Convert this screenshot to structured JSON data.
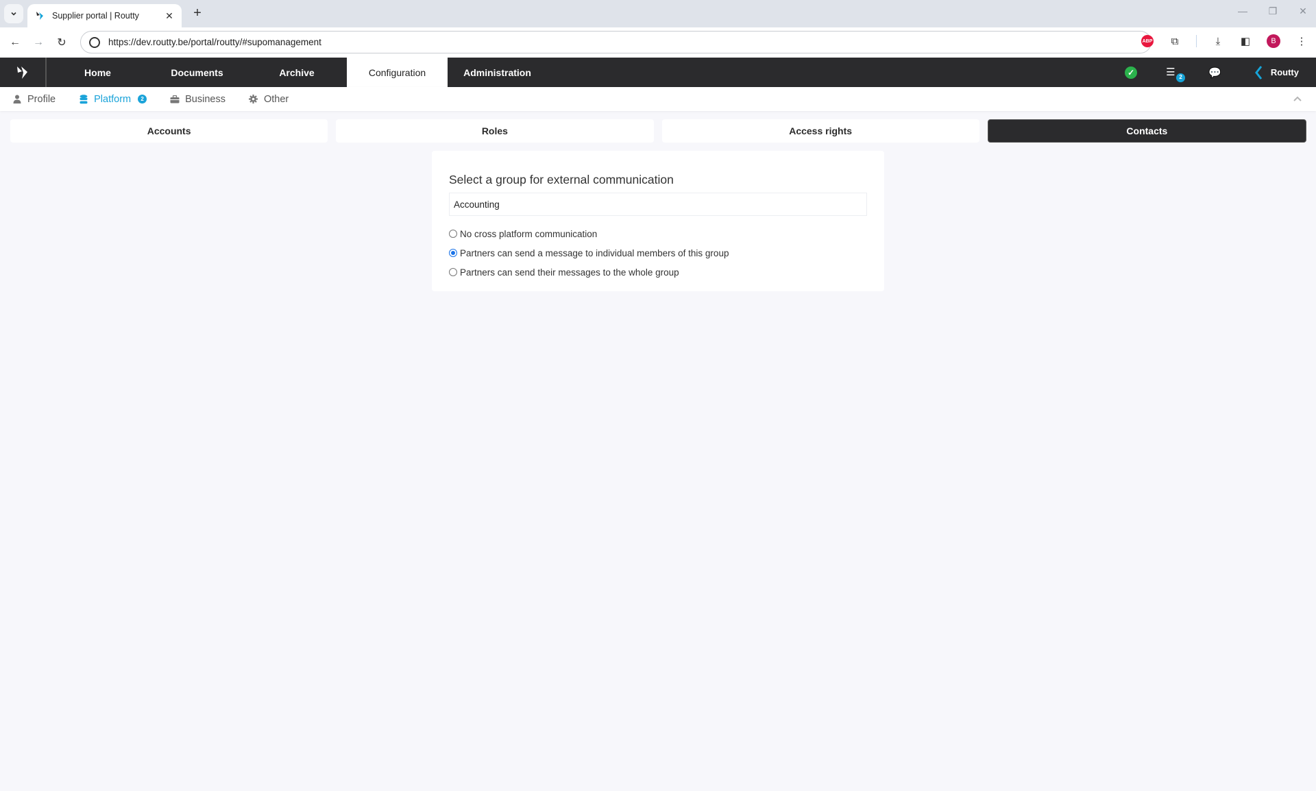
{
  "browser": {
    "tab_title": "Supplier portal | Routty",
    "url": "https://dev.routty.be/portal/routty/#supomanagement",
    "profile_initial": "B",
    "abp_label": "ABP"
  },
  "topnav": {
    "items": [
      {
        "label": "Home",
        "active": false
      },
      {
        "label": "Documents",
        "active": false
      },
      {
        "label": "Archive",
        "active": false
      },
      {
        "label": "Configuration",
        "active": true
      },
      {
        "label": "Administration",
        "active": false
      }
    ],
    "tasks_badge": "2",
    "brand_name": "Routty"
  },
  "subnav": {
    "items": [
      {
        "label": "Profile",
        "icon": "user-icon",
        "active": false
      },
      {
        "label": "Platform",
        "icon": "database-icon",
        "active": true,
        "badge": "2"
      },
      {
        "label": "Business",
        "icon": "briefcase-icon",
        "active": false
      },
      {
        "label": "Other",
        "icon": "gear-icon",
        "active": false
      }
    ]
  },
  "section_tabs": [
    {
      "label": "Accounts",
      "active": false
    },
    {
      "label": "Roles",
      "active": false
    },
    {
      "label": "Access rights",
      "active": false
    },
    {
      "label": "Contacts",
      "active": true
    }
  ],
  "card": {
    "title": "Select a group for external communication",
    "group_value": "Accounting",
    "options": [
      {
        "label": "No cross platform communication",
        "checked": false
      },
      {
        "label": "Partners can send a message to individual members of this group",
        "checked": true
      },
      {
        "label": "Partners can send their messages to the whole group",
        "checked": false
      }
    ]
  },
  "colors": {
    "nav_bg": "#2b2b2d",
    "accent": "#1aa3d9",
    "success": "#2bb24c",
    "page_bg": "#f7f7fb"
  }
}
